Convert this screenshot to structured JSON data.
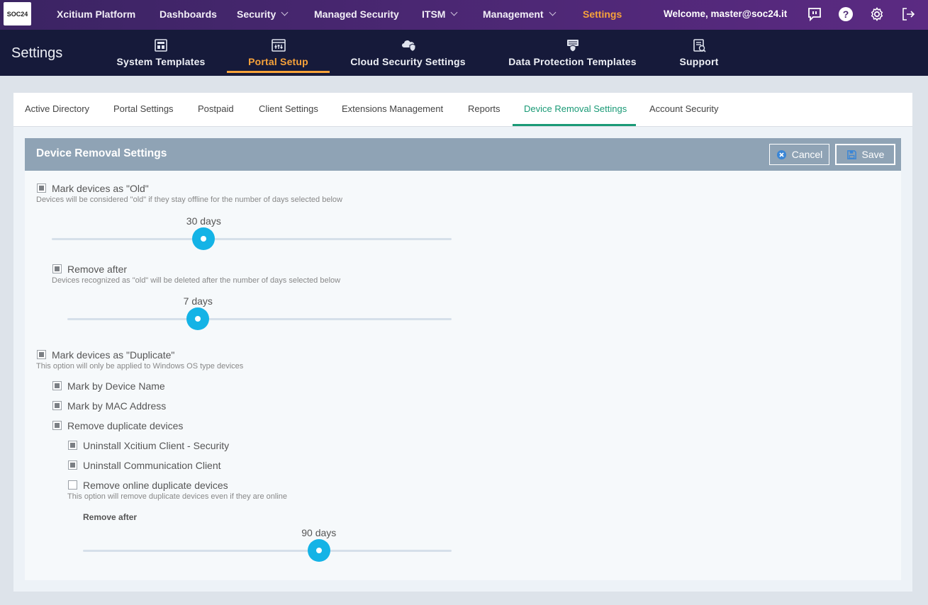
{
  "topnav": {
    "logo_text": "SOC24",
    "items": [
      {
        "label": "Xcitium Platform",
        "has_menu": false
      },
      {
        "label": "Dashboards",
        "has_menu": false
      },
      {
        "label": "Security",
        "has_menu": true
      },
      {
        "label": "Managed Security",
        "has_menu": false
      },
      {
        "label": "ITSM",
        "has_menu": true
      },
      {
        "label": "Management",
        "has_menu": true
      },
      {
        "label": "Settings",
        "has_menu": false,
        "active": true
      }
    ],
    "welcome": "Welcome, master@soc24.it",
    "icons": [
      "feedback-icon",
      "help-icon",
      "gear-icon",
      "logout-icon"
    ]
  },
  "subnav": {
    "title": "Settings",
    "items": [
      {
        "label": "System Templates",
        "icon": "templates-icon"
      },
      {
        "label": "Portal Setup",
        "icon": "portal-setup-icon",
        "active": true
      },
      {
        "label": "Cloud Security Settings",
        "icon": "cloud-security-icon"
      },
      {
        "label": "Data Protection Templates",
        "icon": "data-protection-icon"
      },
      {
        "label": "Support",
        "icon": "support-icon"
      }
    ]
  },
  "tabs": [
    {
      "label": "Active Directory"
    },
    {
      "label": "Portal Settings"
    },
    {
      "label": "Postpaid"
    },
    {
      "label": "Client Settings"
    },
    {
      "label": "Extensions Management"
    },
    {
      "label": "Reports"
    },
    {
      "label": "Device Removal Settings",
      "active": true
    },
    {
      "label": "Account Security"
    }
  ],
  "card": {
    "title": "Device Removal Settings",
    "cancel_label": "Cancel",
    "save_label": "Save"
  },
  "settings": {
    "mark_old": {
      "label": "Mark devices as \"Old\"",
      "checked": true,
      "hint": "Devices will be considered \"old\" if they stay offline for the number of days selected below",
      "slider": {
        "value_label": "30 days",
        "fraction": 0.38
      }
    },
    "remove_after": {
      "label": "Remove after",
      "checked": true,
      "hint": "Devices recognized as \"old\" will be deleted after the number of days selected below",
      "slider": {
        "value_label": "7 days",
        "fraction": 0.34
      }
    },
    "mark_duplicate": {
      "label": "Mark devices as \"Duplicate\"",
      "checked": true,
      "hint": "This option will only be applied to Windows OS type devices"
    },
    "by_device_name": {
      "label": "Mark by Device Name",
      "checked": true
    },
    "by_mac": {
      "label": "Mark by MAC Address",
      "checked": true
    },
    "remove_duplicates": {
      "label": "Remove duplicate devices",
      "checked": true
    },
    "uninstall_security": {
      "label": "Uninstall Xcitium Client - Security",
      "checked": true
    },
    "uninstall_comm": {
      "label": "Uninstall Communication Client",
      "checked": true
    },
    "remove_online": {
      "label": "Remove online duplicate devices",
      "checked": false,
      "hint": "This option will remove duplicate devices even if they are online"
    },
    "duplicate_remove_after": {
      "label": "Remove after",
      "slider": {
        "value_label": "90 days",
        "fraction": 0.64
      }
    }
  },
  "colors": {
    "accent_orange": "#f7a23a",
    "accent_green": "#1a9a76",
    "slider_blue": "#14b3e6",
    "header_grey": "#8fa3b5"
  }
}
